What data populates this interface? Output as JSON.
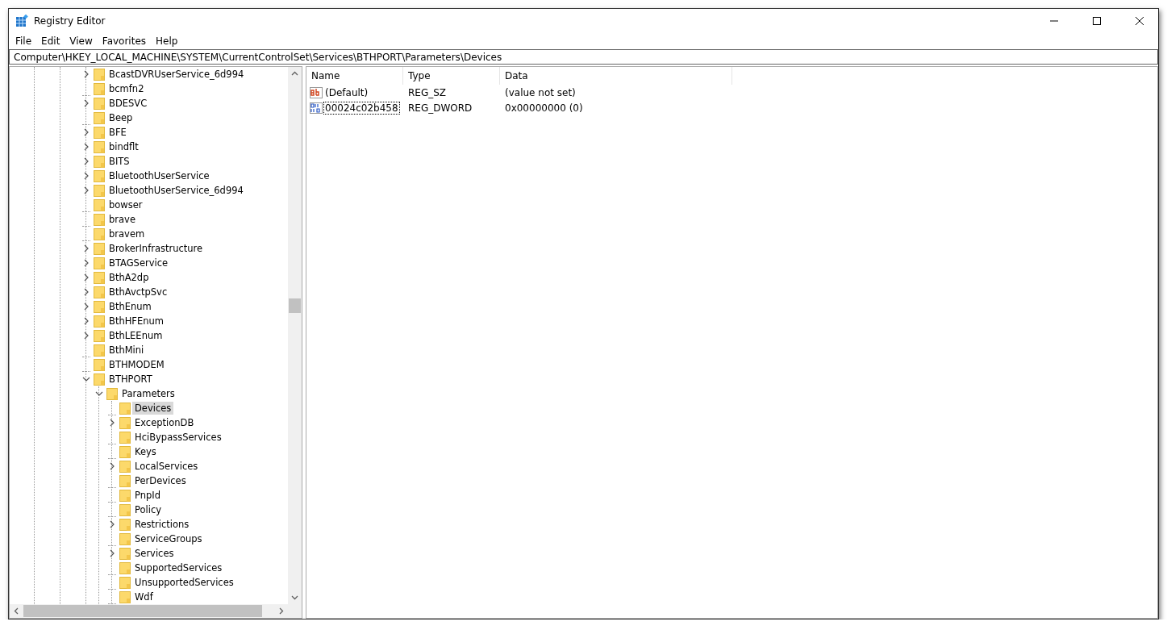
{
  "window": {
    "title": "Registry Editor"
  },
  "menu": [
    "File",
    "Edit",
    "View",
    "Favorites",
    "Help"
  ],
  "address": "Computer\\HKEY_LOCAL_MACHINE\\SYSTEM\\CurrentControlSet\\Services\\BTHPORT\\Parameters\\Devices",
  "tree": [
    {
      "label": "BcastDVRUserService_6d994",
      "kind": "collapsed",
      "selected": false
    },
    {
      "label": "bcmfn2",
      "kind": "leaf",
      "selected": false
    },
    {
      "label": "BDESVC",
      "kind": "collapsed",
      "selected": false
    },
    {
      "label": "Beep",
      "kind": "leaf",
      "selected": false
    },
    {
      "label": "BFE",
      "kind": "collapsed",
      "selected": false
    },
    {
      "label": "bindflt",
      "kind": "collapsed",
      "selected": false
    },
    {
      "label": "BITS",
      "kind": "collapsed",
      "selected": false
    },
    {
      "label": "BluetoothUserService",
      "kind": "collapsed",
      "selected": false
    },
    {
      "label": "BluetoothUserService_6d994",
      "kind": "collapsed",
      "selected": false
    },
    {
      "label": "bowser",
      "kind": "leaf",
      "selected": false
    },
    {
      "label": "brave",
      "kind": "leaf",
      "selected": false
    },
    {
      "label": "bravem",
      "kind": "leaf",
      "selected": false
    },
    {
      "label": "BrokerInfrastructure",
      "kind": "collapsed",
      "selected": false
    },
    {
      "label": "BTAGService",
      "kind": "collapsed",
      "selected": false
    },
    {
      "label": "BthA2dp",
      "kind": "collapsed",
      "selected": false
    },
    {
      "label": "BthAvctpSvc",
      "kind": "collapsed",
      "selected": false
    },
    {
      "label": "BthEnum",
      "kind": "collapsed",
      "selected": false
    },
    {
      "label": "BthHFEnum",
      "kind": "collapsed",
      "selected": false
    },
    {
      "label": "BthLEEnum",
      "kind": "collapsed",
      "selected": false
    },
    {
      "label": "BthMini",
      "kind": "leaf",
      "selected": false
    },
    {
      "label": "BTHMODEM",
      "kind": "leaf",
      "selected": false
    },
    {
      "label": "BTHPORT",
      "kind": "expanded",
      "selected": false,
      "children": [
        {
          "label": "Parameters",
          "kind": "expanded",
          "selected": false,
          "children": [
            {
              "label": "Devices",
              "kind": "leaf",
              "selected": true
            },
            {
              "label": "ExceptionDB",
              "kind": "collapsed",
              "selected": false
            },
            {
              "label": "HciBypassServices",
              "kind": "leaf",
              "selected": false
            },
            {
              "label": "Keys",
              "kind": "leaf",
              "selected": false
            },
            {
              "label": "LocalServices",
              "kind": "collapsed",
              "selected": false
            },
            {
              "label": "PerDevices",
              "kind": "leaf",
              "selected": false
            },
            {
              "label": "PnpId",
              "kind": "leaf",
              "selected": false
            },
            {
              "label": "Policy",
              "kind": "leaf",
              "selected": false
            },
            {
              "label": "Restrictions",
              "kind": "collapsed",
              "selected": false
            },
            {
              "label": "ServiceGroups",
              "kind": "leaf",
              "selected": false
            },
            {
              "label": "Services",
              "kind": "collapsed",
              "selected": false
            },
            {
              "label": "SupportedServices",
              "kind": "leaf",
              "selected": false
            },
            {
              "label": "UnsupportedServices",
              "kind": "leaf",
              "selected": false
            },
            {
              "label": "Wdf",
              "kind": "leaf",
              "selected": false
            }
          ]
        }
      ]
    }
  ],
  "values": {
    "columns": [
      "Name",
      "Type",
      "Data"
    ],
    "rows": [
      {
        "kind": "string",
        "name": "(Default)",
        "type": "REG_SZ",
        "data": "(value not set)",
        "selected": false
      },
      {
        "kind": "binary",
        "name": "00024c02b458",
        "type": "REG_DWORD",
        "data": "0x00000000 (0)",
        "selected": true
      }
    ]
  }
}
